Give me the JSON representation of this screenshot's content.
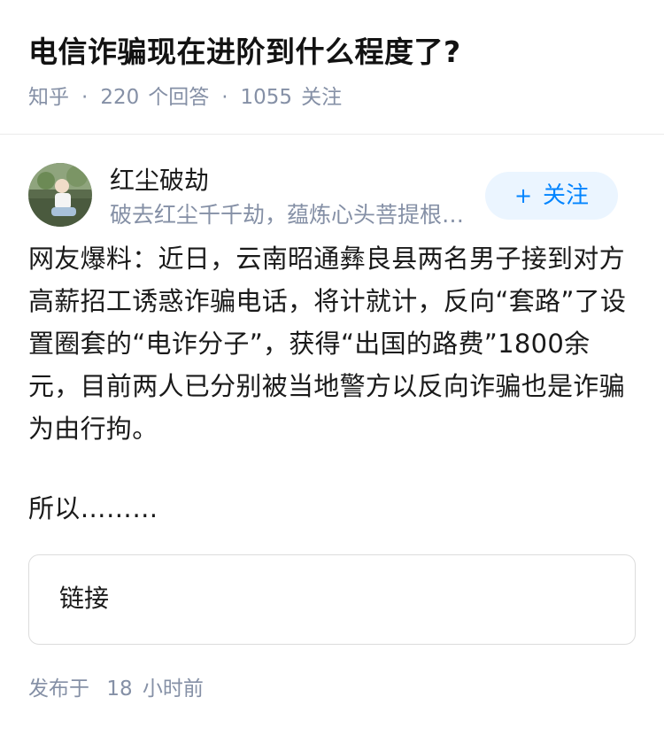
{
  "question": {
    "title": "电信诈骗现在进阶到什么程度了?",
    "source": "知乎",
    "answer_count": "220",
    "answer_label": "个回答",
    "follower_count": "1055",
    "follower_label": "关注"
  },
  "author": {
    "name": "红尘破劫",
    "bio": "破去红尘千千劫，蕴炼心头菩提根…",
    "follow_label": "关注",
    "follow_icon": "plus-icon"
  },
  "answer": {
    "paragraph_1": "网友爆料：近日，云南昭通彝良县两名男子接到对方高薪招工诱惑诈骗电话，将计就计，反向“套路”了设置圈套的“电诈分子”，获得“出国的路费”1800余元，目前两人已分别被当地警方以反向诈骗也是诈骗为由行拘。",
    "paragraph_2": "所以………",
    "link_label": "链接"
  },
  "footer": {
    "published_prefix": "发布于",
    "published_num": "18",
    "published_unit": "小时前"
  },
  "colors": {
    "accent": "#0084ff",
    "accent_bg": "#ebf5ff",
    "meta": "#8590a6"
  }
}
